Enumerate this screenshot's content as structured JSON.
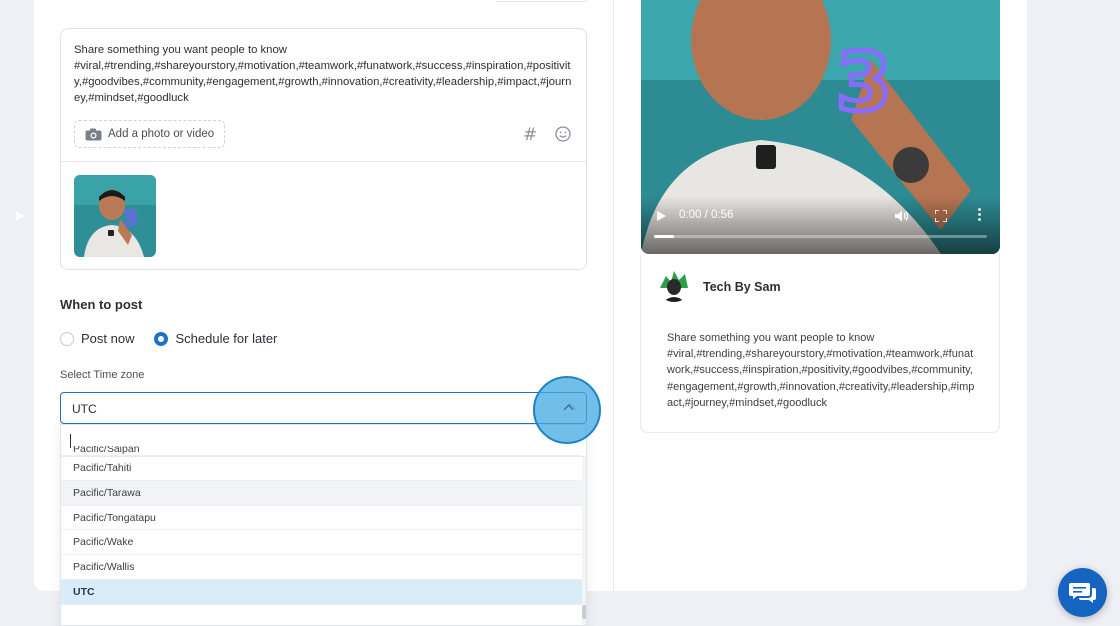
{
  "composer": {
    "text_line1": "Share something you want people to know",
    "hashtags": "#viral,#trending,#shareyourstory,#motivation,#teamwork,#funatwork,#success,#inspiration,#positivity,#goodvibes,#community,#engagement,#growth,#innovation,#creativity,#leadership,#impact,#journey,#mindset,#goodluck",
    "add_media_label": "Add a photo or video"
  },
  "schedule": {
    "title": "When to post",
    "options": [
      {
        "label": "Post now",
        "checked": false
      },
      {
        "label": "Schedule for later",
        "checked": true
      }
    ],
    "timezone_label": "Select Time zone",
    "timezone_value": "UTC",
    "timezone_options": [
      "Pacific/Saipan",
      "Pacific/Tahiti",
      "Pacific/Tarawa",
      "Pacific/Tongatapu",
      "Pacific/Wake",
      "Pacific/Wallis",
      "UTC"
    ],
    "hovered_option": "Pacific/Tarawa",
    "selected_option": "UTC"
  },
  "preview": {
    "video_time": "0:00 / 0:56",
    "video_progress": 0.06,
    "author": "Tech By Sam",
    "text_line1": "Share something you want people to know",
    "hashtags": "#viral,#trending,#shareyourstory,#motivation,#teamwork,#funatwork,#success,#inspiration,#positivity,#goodvibes,#community,#engagement,#growth,#innovation,#creativity,#leadership,#impact,#journey,#mindset,#goodluck"
  },
  "colors": {
    "accent": "#1a73c7",
    "selected_row": "#d9ecf8",
    "chat_button": "#1565c0"
  },
  "icons": [
    "camera-icon",
    "hashtag-icon",
    "emoji-icon",
    "chevron-up-icon",
    "play-icon",
    "volume-icon",
    "fullscreen-icon",
    "more-vertical-icon",
    "chat-icon"
  ]
}
